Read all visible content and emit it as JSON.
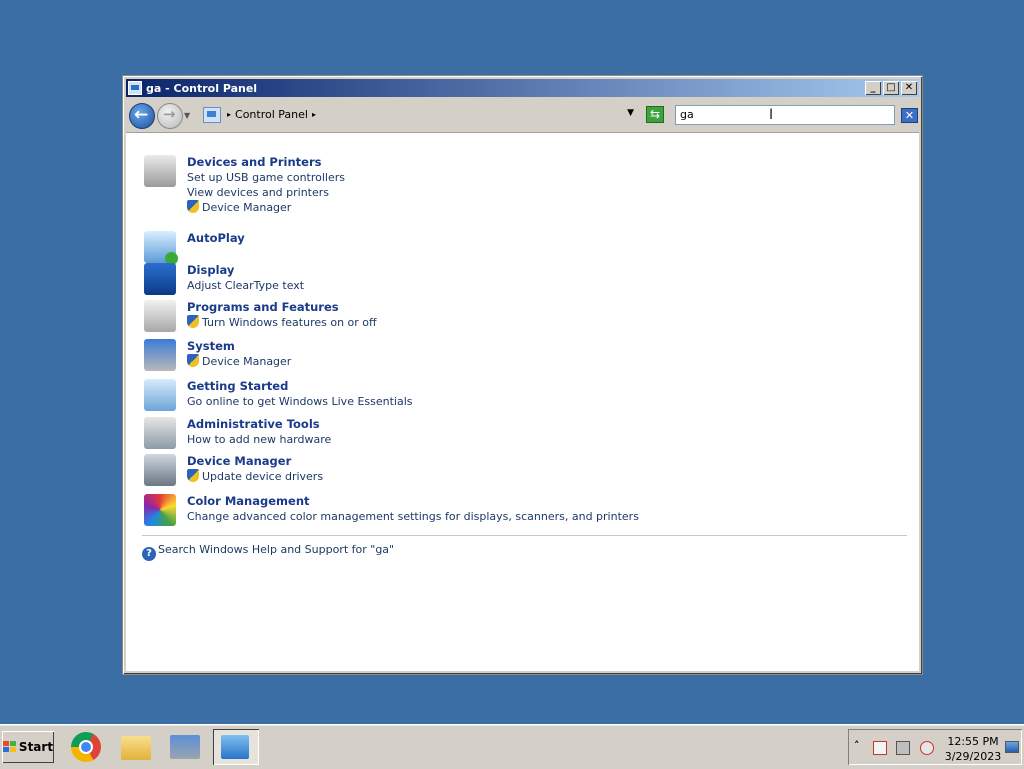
{
  "window": {
    "title": "ga - Control Panel",
    "controls": {
      "minimize": "_",
      "maximize": "□",
      "close": "✕"
    }
  },
  "navbar": {
    "breadcrumb": "Control Panel",
    "search_value": "ga"
  },
  "results": [
    {
      "title": "Devices and Printers",
      "links": [
        {
          "text": "Set up USB game controllers",
          "shield": false
        },
        {
          "text": "View devices and printers",
          "shield": false
        },
        {
          "text": "Device Manager",
          "shield": true
        }
      ]
    },
    {
      "title": "AutoPlay",
      "links": []
    },
    {
      "title": "Display",
      "links": [
        {
          "text": "Adjust ClearType text",
          "shield": false
        }
      ]
    },
    {
      "title": "Programs and Features",
      "links": [
        {
          "text": "Turn Windows features on or off",
          "shield": true
        }
      ]
    },
    {
      "title": "System",
      "links": [
        {
          "text": "Device Manager",
          "shield": true
        }
      ]
    },
    {
      "title": "Getting Started",
      "links": [
        {
          "text": "Go online to get Windows Live Essentials",
          "shield": false
        }
      ]
    },
    {
      "title": "Administrative Tools",
      "links": [
        {
          "text": "How to add new hardware",
          "shield": false
        }
      ]
    },
    {
      "title": "Device Manager",
      "links": [
        {
          "text": "Update device drivers",
          "shield": true
        }
      ]
    },
    {
      "title": "Color Management",
      "links": [
        {
          "text": "Change advanced color management settings for displays, scanners, and printers",
          "shield": false
        }
      ]
    }
  ],
  "help_link": "Search Windows Help and Support for \"ga\"",
  "taskbar": {
    "start_label": "Start",
    "apps": [
      "chrome-icon",
      "folder-icon",
      "keyboard-icon",
      "control-panel-icon"
    ],
    "clock_time": "12:55 PM",
    "clock_date": "3/29/2023"
  }
}
